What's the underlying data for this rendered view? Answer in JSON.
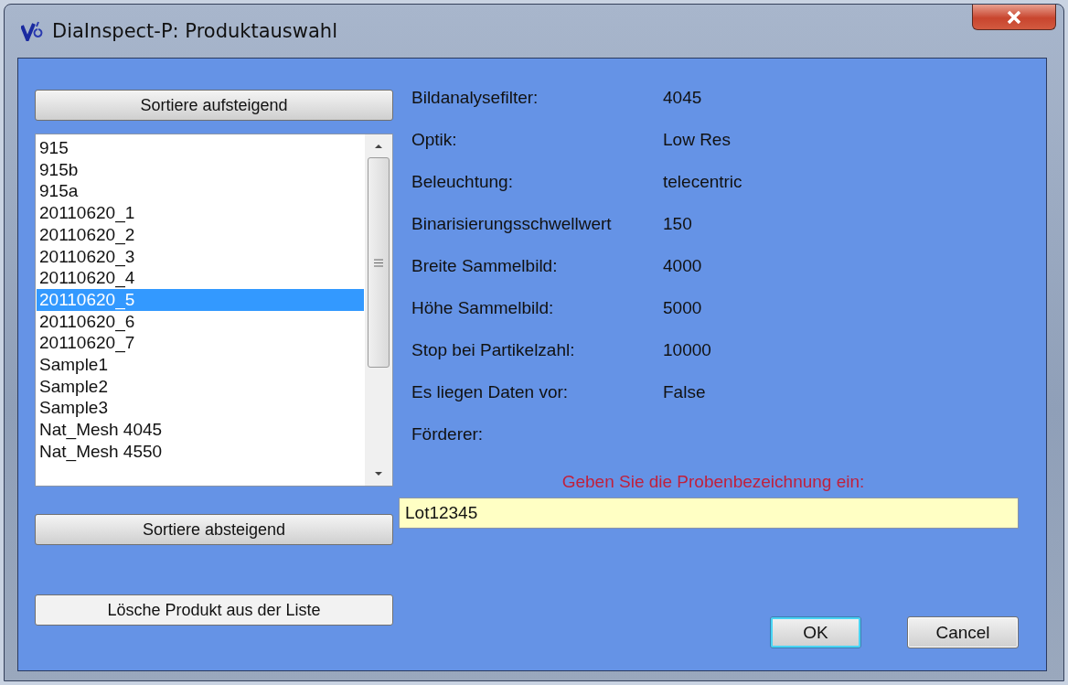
{
  "window": {
    "title": "DiaInspect-P: Produktauswahl"
  },
  "sort_ascending_button": "Sortiere aufsteigend",
  "product_list": [
    {
      "label": "915",
      "selected": false
    },
    {
      "label": "915b",
      "selected": false
    },
    {
      "label": "915a",
      "selected": false
    },
    {
      "label": "20110620_1",
      "selected": false
    },
    {
      "label": "20110620_2",
      "selected": false
    },
    {
      "label": "20110620_3",
      "selected": false
    },
    {
      "label": "20110620_4",
      "selected": false
    },
    {
      "label": "20110620_5",
      "selected": true
    },
    {
      "label": "20110620_6",
      "selected": false
    },
    {
      "label": "20110620_7",
      "selected": false
    },
    {
      "label": "Sample1",
      "selected": false
    },
    {
      "label": "Sample2",
      "selected": false
    },
    {
      "label": "Sample3",
      "selected": false
    },
    {
      "label": "Nat_Mesh 4045",
      "selected": false
    },
    {
      "label": "Nat_Mesh 4550",
      "selected": false
    }
  ],
  "sort_descending_button": "Sortiere absteigend",
  "delete_button": "Lösche Produkt aus der Liste",
  "properties": [
    {
      "label": "Bildanalysefilter:",
      "value": "4045"
    },
    {
      "label": "Optik:",
      "value": "Low Res"
    },
    {
      "label": "Beleuchtung:",
      "value": "telecentric"
    },
    {
      "label": "Binarisierungsschwellwert",
      "value": "150"
    },
    {
      "label": "Breite Sammelbild:",
      "value": "4000"
    },
    {
      "label": "Höhe Sammelbild:",
      "value": "5000"
    },
    {
      "label": "Stop bei Partikelzahl:",
      "value": "10000"
    },
    {
      "label": "Es liegen Daten vor:",
      "value": "False"
    },
    {
      "label": "Förderer:"
    }
  ],
  "sample_prompt": "Geben Sie die Probenbezeichnung ein:",
  "sample_field": {
    "value": "Lot12345"
  },
  "buttons": [
    "OK",
    "Cancel"
  ]
}
